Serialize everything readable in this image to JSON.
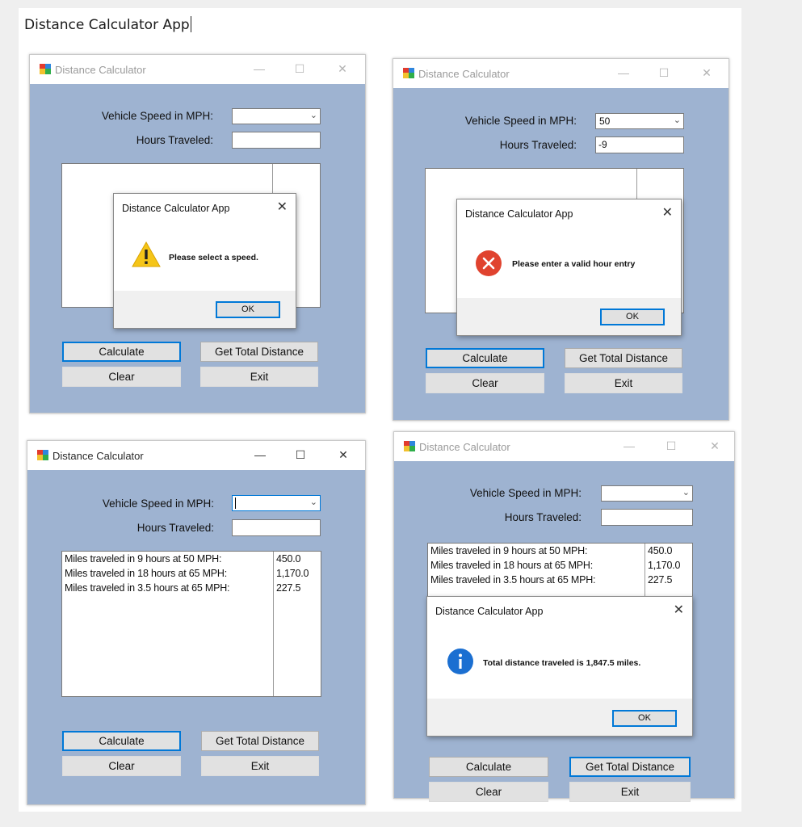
{
  "document": {
    "title": "Distance Calculator App"
  },
  "window": {
    "title": "Distance Calculator",
    "minimize_glyph": "—",
    "maximize_glyph": "☐",
    "close_glyph": "✕",
    "speed_label": "Vehicle Speed in MPH:",
    "hours_label": "Hours Traveled:",
    "calculate_label": "Calculate",
    "total_label": "Get Total Distance",
    "clear_label": "Clear",
    "exit_label": "Exit"
  },
  "dialog": {
    "title": "Distance Calculator App",
    "ok_label": "OK",
    "close_glyph": "✕"
  },
  "panels": [
    {
      "state": "warning-select-speed",
      "speed_value": "",
      "hours_value": "",
      "dialog_icon": "warning-icon",
      "dialog_message": "Please select a speed."
    },
    {
      "state": "error-invalid-hours",
      "speed_value": "50",
      "hours_value": "-9",
      "dialog_icon": "error-icon",
      "dialog_message": "Please enter a valid hour entry"
    },
    {
      "state": "results-list",
      "speed_value": "",
      "hours_value": "",
      "results": [
        {
          "description": "Miles traveled in 9 hours at 50 MPH:",
          "miles": "450.0"
        },
        {
          "description": "Miles traveled in 18 hours at 65 MPH:",
          "miles": "1,170.0"
        },
        {
          "description": "Miles traveled in 3.5 hours at 65 MPH:",
          "miles": "227.5"
        }
      ]
    },
    {
      "state": "info-total",
      "speed_value": "",
      "hours_value": "",
      "results": [
        {
          "description": "Miles traveled in 9 hours at 50 MPH:",
          "miles": "450.0"
        },
        {
          "description": "Miles traveled in 18 hours at 65 MPH:",
          "miles": "1,170.0"
        },
        {
          "description": "Miles traveled in 3.5 hours at 65 MPH:",
          "miles": "227.5"
        }
      ],
      "dialog_icon": "info-icon",
      "dialog_message": "Total distance traveled is 1,847.5 miles."
    }
  ],
  "colors": {
    "client_background": "#9eb3d1",
    "accent_focus": "#0078d7",
    "warning": "#f5c518",
    "error": "#e0432f",
    "info": "#1b6fd1"
  }
}
